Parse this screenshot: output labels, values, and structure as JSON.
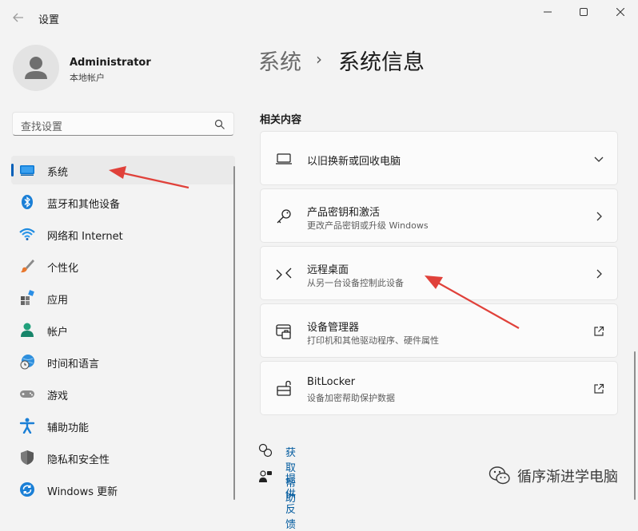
{
  "window": {
    "app_title": "设置",
    "buttons": [
      "minimize-icon",
      "maximize-icon",
      "close-icon"
    ]
  },
  "profile": {
    "name": "Administrator",
    "account_type": "本地帐户"
  },
  "search": {
    "placeholder": "查找设置"
  },
  "sidebar": {
    "items": [
      {
        "label": "系统",
        "icon": "system-icon",
        "active": true
      },
      {
        "label": "蓝牙和其他设备",
        "icon": "bluetooth-icon"
      },
      {
        "label": "网络和 Internet",
        "icon": "wifi-icon"
      },
      {
        "label": "个性化",
        "icon": "brush-icon"
      },
      {
        "label": "应用",
        "icon": "apps-icon"
      },
      {
        "label": "帐户",
        "icon": "account-icon"
      },
      {
        "label": "时间和语言",
        "icon": "globe-clock-icon"
      },
      {
        "label": "游戏",
        "icon": "gamepad-icon"
      },
      {
        "label": "辅助功能",
        "icon": "accessibility-icon"
      },
      {
        "label": "隐私和安全性",
        "icon": "shield-icon"
      },
      {
        "label": "Windows 更新",
        "icon": "update-icon"
      }
    ]
  },
  "breadcrumb": {
    "parent": "系统",
    "separator": "›",
    "current": "系统信息"
  },
  "related": {
    "title": "相关内容",
    "cards": [
      {
        "title": "以旧换新或回收电脑",
        "subtitle": "",
        "icon": "laptop-icon",
        "action": "chevron-down-icon"
      },
      {
        "title": "产品密钥和激活",
        "subtitle": "更改产品密钥或升级 Windows",
        "icon": "key-icon",
        "action": "chevron-right-icon"
      },
      {
        "title": "远程桌面",
        "subtitle": "从另一台设备控制此设备",
        "icon": "remote-desktop-icon",
        "action": "chevron-right-icon"
      },
      {
        "title": "设备管理器",
        "subtitle": "打印机和其他驱动程序、硬件属性",
        "icon": "device-manager-icon",
        "action": "external-link-icon"
      },
      {
        "title": "BitLocker",
        "subtitle": "设备加密帮助保护数据",
        "icon": "lock-icon",
        "action": "external-link-icon"
      }
    ]
  },
  "help": {
    "get_help": "获取帮助",
    "feedback": "提供反馈"
  },
  "watermark": {
    "text": "循序渐进学电脑"
  },
  "colors": {
    "accent": "#005fb8",
    "annotation_arrow": "#e0413a",
    "link": "#005a9e"
  }
}
